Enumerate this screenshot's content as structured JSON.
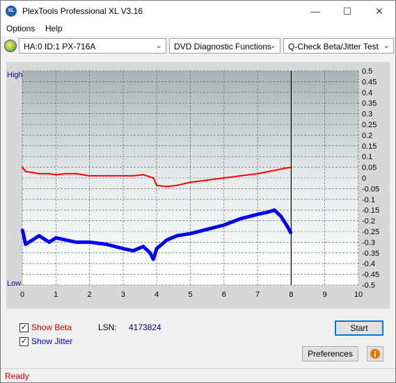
{
  "window": {
    "title": "PlexTools Professional XL V3.16",
    "app_icon_text": "XL"
  },
  "menu": [
    {
      "label": "Options"
    },
    {
      "label": "Help"
    }
  ],
  "toolbar": {
    "drive": "HA:0 ID:1  PX-716A",
    "function": "DVD Diagnostic Functions",
    "test": "Q-Check Beta/Jitter Test"
  },
  "chart_data": {
    "type": "line",
    "y_left_labels": {
      "top": "High",
      "bottom": "Low"
    },
    "x_ticks": [
      "0",
      "1",
      "2",
      "3",
      "4",
      "5",
      "6",
      "7",
      "8",
      "9",
      "10"
    ],
    "xlim": [
      0,
      10
    ],
    "y_ticks": [
      "0.5",
      "0.45",
      "0.4",
      "0.35",
      "0.3",
      "0.25",
      "0.2",
      "0.15",
      "0.1",
      "0.05",
      "0",
      "-0.05",
      "-0.1",
      "-0.15",
      "-0.2",
      "-0.25",
      "-0.3",
      "-0.35",
      "-0.4",
      "-0.45",
      "-0.5"
    ],
    "ylim": [
      -0.5,
      0.5
    ],
    "grid": true,
    "marker_x": 8.0,
    "series": [
      {
        "color": "#ff0000",
        "x": [
          0,
          0.1,
          0.3,
          0.5,
          0.8,
          1,
          1.3,
          1.6,
          2,
          2.5,
          3,
          3.3,
          3.6,
          3.9,
          4,
          4.3,
          4.6,
          5,
          5.5,
          6,
          6.5,
          7,
          7.5,
          7.8,
          8
        ],
        "y": [
          0.05,
          0.03,
          0.025,
          0.02,
          0.02,
          0.015,
          0.02,
          0.02,
          0.01,
          0.01,
          0.01,
          0.01,
          0.015,
          0.0,
          -0.035,
          -0.04,
          -0.035,
          -0.02,
          -0.01,
          0.0,
          0.01,
          0.02,
          0.035,
          0.045,
          0.05
        ]
      },
      {
        "color": "#0000ff",
        "x": [
          0,
          0.1,
          0.3,
          0.5,
          0.8,
          1,
          1.3,
          1.6,
          2,
          2.5,
          3,
          3.3,
          3.6,
          3.8,
          3.9,
          4,
          4.3,
          4.6,
          5,
          5.5,
          6,
          6.5,
          7,
          7.3,
          7.5,
          7.7,
          7.9,
          8
        ],
        "y": [
          -0.24,
          -0.31,
          -0.29,
          -0.27,
          -0.3,
          -0.28,
          -0.29,
          -0.3,
          -0.3,
          -0.31,
          -0.33,
          -0.34,
          -0.32,
          -0.35,
          -0.38,
          -0.33,
          -0.29,
          -0.27,
          -0.26,
          -0.24,
          -0.22,
          -0.19,
          -0.17,
          -0.16,
          -0.15,
          -0.18,
          -0.23,
          -0.26
        ]
      }
    ]
  },
  "options": {
    "show_beta": {
      "label": "Show Beta",
      "checked": true
    },
    "show_jitter": {
      "label": "Show Jitter",
      "checked": true
    }
  },
  "lsn": {
    "label": "LSN:",
    "value": "4173824"
  },
  "buttons": {
    "start": "Start",
    "preferences": "Preferences"
  },
  "status": "Ready"
}
